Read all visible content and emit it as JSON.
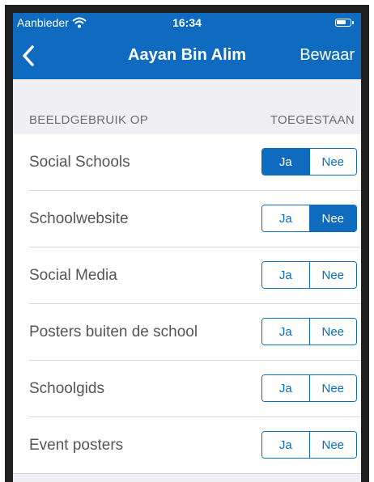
{
  "status_bar": {
    "carrier": "Aanbieder",
    "time": "16:34",
    "wifi_icon": "wifi-icon",
    "battery_icon": "battery-icon"
  },
  "nav": {
    "back_icon": "chevron-left-icon",
    "title": "Aayan Bin Alim",
    "save_label": "Bewaar"
  },
  "section": {
    "header_left": "BEELDGEBRUIK OP",
    "header_right": "TOEGESTAAN"
  },
  "segment_labels": {
    "yes": "Ja",
    "no": "Nee"
  },
  "rows": [
    {
      "label": "Social Schools",
      "selected": "Ja"
    },
    {
      "label": "Schoolwebsite",
      "selected": "Nee"
    },
    {
      "label": "Social Media",
      "selected": ""
    },
    {
      "label": "Posters buiten de school",
      "selected": ""
    },
    {
      "label": "Schoolgids",
      "selected": ""
    },
    {
      "label": "Event posters",
      "selected": ""
    }
  ],
  "colors": {
    "accent": "#0e6bbf",
    "background": "#efeff4",
    "header_text": "#6d6d72",
    "row_text": "#555555"
  }
}
